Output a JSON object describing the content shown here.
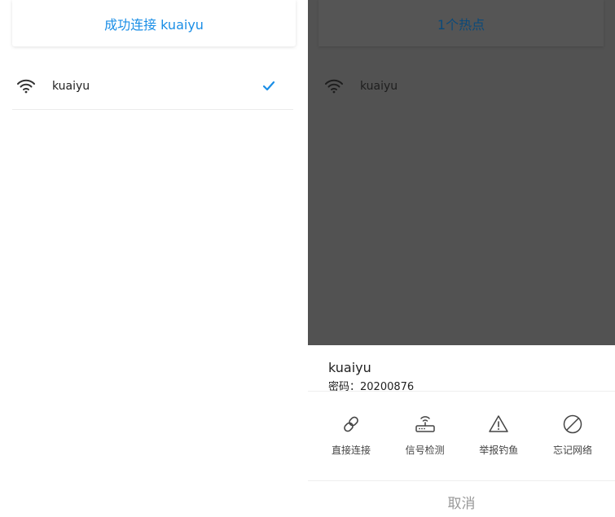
{
  "left": {
    "header_title": "成功连接 kuaiyu",
    "networks": [
      {
        "ssid": "kuaiyu",
        "icon": "wifi-icon",
        "connected_icon": "check-icon"
      }
    ]
  },
  "right": {
    "header_title": "1个热点",
    "networks": [
      {
        "ssid": "kuaiyu",
        "icon": "wifi-icon"
      }
    ],
    "sheet": {
      "network_name": "kuaiyu",
      "password_label": "密码：20200876",
      "actions": [
        {
          "label": "直接连接",
          "icon": "link-icon"
        },
        {
          "label": "信号检测",
          "icon": "router-icon"
        },
        {
          "label": "举报钓鱼",
          "icon": "warning-icon"
        },
        {
          "label": "忘记网络",
          "icon": "forget-icon"
        }
      ],
      "cancel_label": "取消"
    }
  },
  "colors": {
    "accent": "#1a8ee6",
    "overlay": "#525252",
    "muted": "#999999"
  }
}
